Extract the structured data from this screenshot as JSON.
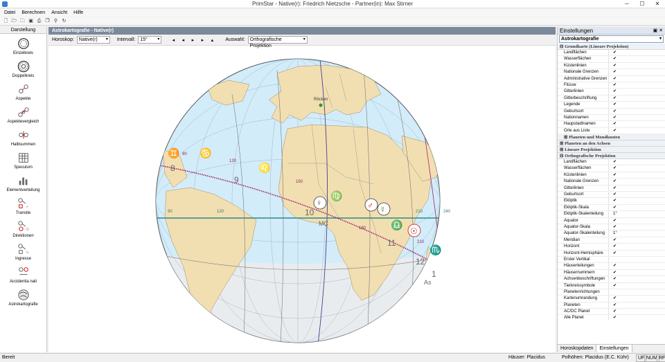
{
  "window": {
    "title": "PrimStar - Native(r): Friedrich Nietzsche - Partner(in): Max Stirner"
  },
  "menu": [
    "Datei",
    "Berechnen",
    "Ansicht",
    "Hilfe"
  ],
  "left_panel": {
    "header": "Darstellung",
    "items": [
      "Einzelkreis",
      "Doppelkreis",
      "Aspekte",
      "Aspektevergleich",
      "Halbsummen",
      "Speculum",
      "Elementverteilung",
      "Transite",
      "Direktionen",
      "Ingresse",
      "Accidentia nati",
      "Astrokartografie"
    ]
  },
  "center": {
    "header": "Astrokartografie - Native(r)",
    "horoskop_label": "Horoskop:",
    "horoskop_value": "Native(r)",
    "intervall_label": "Intervall:",
    "intervall_value": "15°",
    "auswahl_label": "Auswahl:",
    "auswahl_value": "Orthografische Projektion",
    "nav": [
      "◂",
      "◂",
      "▸",
      "▸",
      "▴"
    ],
    "map": {
      "city": "Röcken",
      "degree_labels": [
        "90",
        "120",
        "150",
        "180",
        "210",
        "240",
        "90",
        "120"
      ],
      "house_numbers": [
        "8",
        "9",
        "10",
        "11",
        "12",
        "1"
      ],
      "mc_label": "MC",
      "as_label": "As",
      "signs": {
        "gemini": "♊",
        "cancer": "♋",
        "leo": "♌",
        "virgo": "♍",
        "libra": "♎",
        "scorpio": "♏"
      },
      "planets": {
        "venus": "♀",
        "mars": "♂",
        "mercury": "☿",
        "sun": "☉"
      },
      "colors": {
        "ocean": "#d3ecfa",
        "land": "#f2dfb1",
        "ecliptic": "#a0206e",
        "equator": "#2b8a86",
        "border": "#6e6e6e"
      }
    }
  },
  "right_panel": {
    "header": "Einstellungen",
    "pin": "▣ ✕",
    "selected": "Astrokartografie",
    "sections": [
      {
        "title": "Grundkarte (Lineare Projektion)",
        "collapsed": false,
        "rows": [
          {
            "label": "Landflächen",
            "value": "✔"
          },
          {
            "label": "Wasserflächen",
            "value": "✔"
          },
          {
            "label": "Küstenlinien",
            "value": "✔"
          },
          {
            "label": "Nationale Grenzen",
            "value": "✔"
          },
          {
            "label": "Administrative Grenzen",
            "value": "✔"
          },
          {
            "label": "Flüsse",
            "value": "✔"
          },
          {
            "label": "Gitterlinien",
            "value": "✔"
          },
          {
            "label": "Gitterbeschriftung",
            "value": "✔"
          },
          {
            "label": "Legende",
            "value": "✔"
          },
          {
            "label": "Geburtsort",
            "value": "✔"
          },
          {
            "label": "Nationnamen",
            "value": "✔"
          },
          {
            "label": "Haupstadtnamen",
            "value": "✔"
          },
          {
            "label": "Orte aus Liste",
            "value": "✔"
          }
        ]
      },
      {
        "title": "Planeten und Mondknoten",
        "collapsed": true,
        "sub": true,
        "rows": []
      },
      {
        "title": "Planeten an den Achsen",
        "collapsed": true,
        "rows": []
      },
      {
        "title": "Lineare Projektion",
        "collapsed": true,
        "rows": []
      },
      {
        "title": "Orthografische Projektion",
        "collapsed": false,
        "rows": [
          {
            "label": "Landflächen",
            "value": "✔"
          },
          {
            "label": "Wasserflächen",
            "value": "✔"
          },
          {
            "label": "Küstenlinien",
            "value": "✔"
          },
          {
            "label": "Nationale Grenzen",
            "value": "✔"
          },
          {
            "label": "Gitterlinien",
            "value": "✔"
          },
          {
            "label": "Geburtsort",
            "value": "✔"
          },
          {
            "label": "Ekliptik",
            "value": "✔"
          },
          {
            "label": "Ekliptik-Skala",
            "value": "✔"
          },
          {
            "label": "Ekliptik-Skalenteilung",
            "value": "1°"
          },
          {
            "label": "Äquator",
            "value": "✔"
          },
          {
            "label": "Äquator-Skala",
            "value": "✔"
          },
          {
            "label": "Äquator-Skalenteilung",
            "value": "1°"
          },
          {
            "label": "Meridian",
            "value": "✔"
          },
          {
            "label": "Horizont",
            "value": "✔"
          },
          {
            "label": "Horizont-Hemisphäre",
            "value": "✔"
          },
          {
            "label": "Erster Vertikal",
            "value": ""
          },
          {
            "label": "Häuserteilungen",
            "value": "✔"
          },
          {
            "label": "Häusernummern",
            "value": "✔"
          },
          {
            "label": "Achsenbeschriftungen",
            "value": "✔"
          },
          {
            "label": "Tierkreissymbole",
            "value": "✔"
          },
          {
            "label": "Planetenrichtungen",
            "value": ""
          },
          {
            "label": "Kartenumrandung",
            "value": "✔"
          },
          {
            "label": "Planeten",
            "value": "✔"
          },
          {
            "label": "AC/DC Planet",
            "value": "✔"
          },
          {
            "label": "Alle Planet",
            "value": "✔"
          }
        ]
      }
    ],
    "tabs": [
      "Horoskopdaten",
      "Einstellungen"
    ]
  },
  "status": {
    "left": "Bereit",
    "houses": "Häuser: Placidus",
    "poles": "Polhöhen: Placidus (E.C. Kühr)",
    "ind1": "UF",
    "ind2": "NUM",
    "ind3": "RF"
  }
}
